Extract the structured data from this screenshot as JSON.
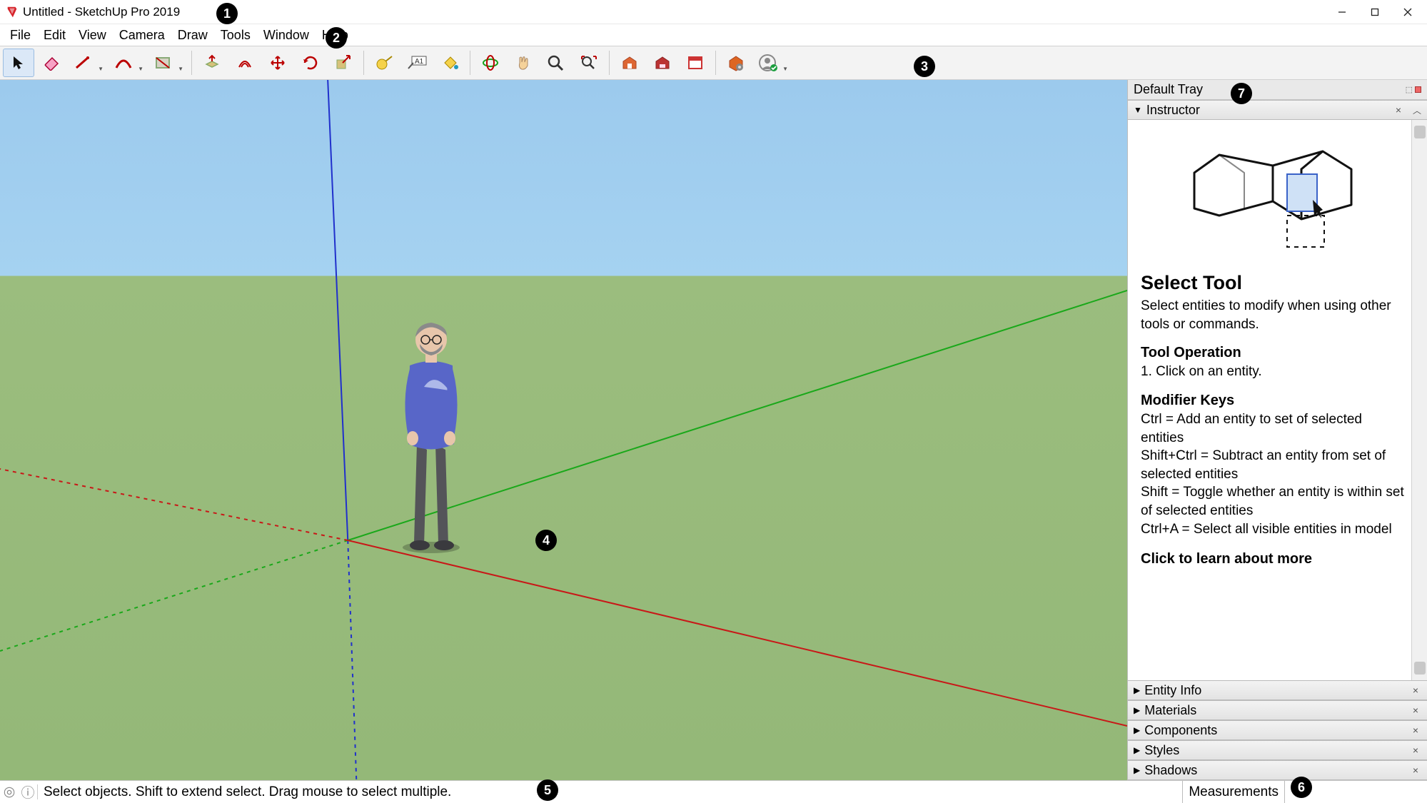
{
  "title": "Untitled - SketchUp Pro 2019",
  "menubar": [
    "File",
    "Edit",
    "View",
    "Camera",
    "Draw",
    "Tools",
    "Window",
    "Help"
  ],
  "toolbar": [
    {
      "name": "select-tool",
      "active": true
    },
    {
      "name": "eraser-tool"
    },
    {
      "name": "line-tool",
      "dd": true
    },
    {
      "name": "arc-tool",
      "dd": true
    },
    {
      "name": "shape-tool",
      "dd": true
    },
    {
      "sep": true
    },
    {
      "name": "push-pull-tool"
    },
    {
      "name": "offset-tool"
    },
    {
      "name": "move-tool"
    },
    {
      "name": "rotate-tool"
    },
    {
      "name": "scale-tool"
    },
    {
      "sep": true
    },
    {
      "name": "tape-measure-tool"
    },
    {
      "name": "text-tool"
    },
    {
      "name": "paint-bucket-tool"
    },
    {
      "sep": true
    },
    {
      "name": "orbit-tool"
    },
    {
      "name": "pan-tool"
    },
    {
      "name": "zoom-tool"
    },
    {
      "name": "zoom-extents-tool"
    },
    {
      "sep": true
    },
    {
      "name": "3d-warehouse-tool"
    },
    {
      "name": "extension-warehouse-tool"
    },
    {
      "name": "layout-tool"
    },
    {
      "sep": true
    },
    {
      "name": "extension-manager-tool"
    },
    {
      "name": "user-account-tool",
      "dd": true
    }
  ],
  "tray_title": "Default Tray",
  "instructor": {
    "panel_label": "Instructor",
    "title": "Select Tool",
    "sub": "Select entities to modify when using other tools or commands.",
    "op_h": "Tool Operation",
    "op_1": "1. Click on an entity.",
    "mk_h": "Modifier Keys",
    "mk_1": "Ctrl = Add an entity to set of selected entities",
    "mk_2": "Shift+Ctrl = Subtract an entity from set of selected entities",
    "mk_3": "Shift = Toggle whether an entity is within set of selected entities",
    "mk_4": "Ctrl+A = Select all visible entities in model",
    "more": "Click to learn about more"
  },
  "collapsed_panels": [
    "Entity Info",
    "Materials",
    "Components",
    "Styles",
    "Shadows"
  ],
  "status_text": "Select objects. Shift to extend select. Drag mouse to select multiple.",
  "measure_label": "Measurements",
  "callouts": [
    "1",
    "2",
    "3",
    "4",
    "5",
    "6",
    "7"
  ]
}
